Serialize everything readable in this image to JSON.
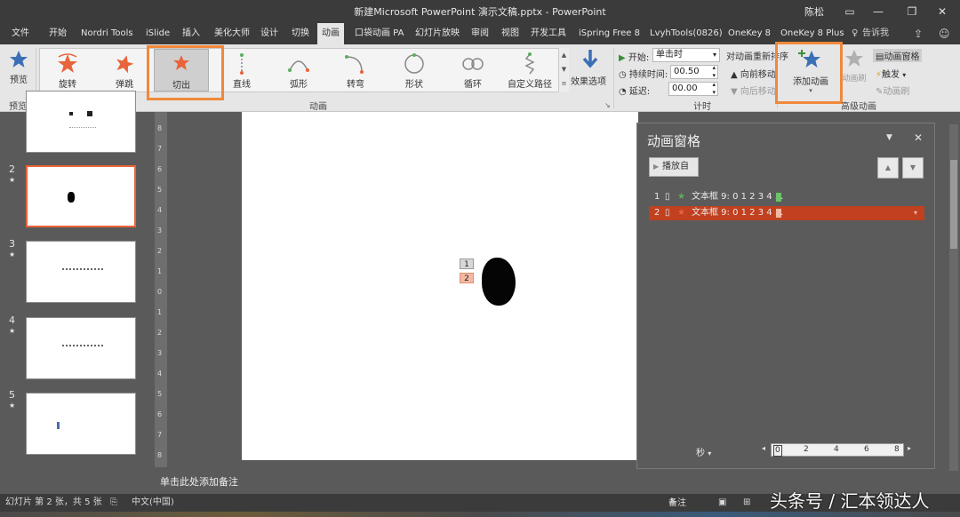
{
  "window": {
    "title": "新建Microsoft PowerPoint 演示文稿.pptx  -  PowerPoint",
    "user": "陈松"
  },
  "tabs": [
    "文件",
    "开始",
    "Nordri Tools",
    "iSlide",
    "插入",
    "美化大师",
    "设计",
    "切换",
    "动画",
    "口袋动画 PA",
    "幻灯片放映",
    "审阅",
    "视图",
    "开发工具",
    "iSpring Free 8",
    "LvyhTools(0826)",
    "OneKey 8",
    "OneKey 8 Plus"
  ],
  "tell_me": "告诉我",
  "ribbon": {
    "preview_label": "预览",
    "preview_group": "预览",
    "animations": [
      "旋转",
      "弹跳",
      "切出",
      "直线",
      "弧形",
      "转弯",
      "形状",
      "循环",
      "自定义路径"
    ],
    "effect_options": "效果选项",
    "animation_group": "动画",
    "timing": {
      "start_label": "开始:",
      "start_value": "单击时",
      "duration_label": "持续时间:",
      "duration_value": "00.50",
      "delay_label": "延迟:",
      "delay_value": "00.00",
      "reorder_title": "对动画重新排序",
      "move_earlier": "向前移动",
      "move_later": "向后移动",
      "group": "计时"
    },
    "advanced": {
      "add_animation": "添加动画",
      "animation_painter": "动画刷",
      "animation_pane": "动画窗格",
      "trigger": "触发",
      "animation_brush": "动画刷",
      "group": "高级动画"
    }
  },
  "slides": [
    {
      "num": "2",
      "star": "★"
    },
    {
      "num": "3",
      "star": "★"
    },
    {
      "num": "4",
      "star": "★"
    },
    {
      "num": "5",
      "star": "★"
    }
  ],
  "ruler": [
    "8",
    "7",
    "6",
    "5",
    "4",
    "3",
    "2",
    "1",
    "0",
    "1",
    "2",
    "3",
    "4",
    "5",
    "6",
    "7",
    "8"
  ],
  "canvas_tags": [
    "1",
    "2"
  ],
  "anim_pane": {
    "title": "动画窗格",
    "play_from": "播放自",
    "items": [
      {
        "order": "1",
        "text": "文本框 9: 0 1 2 3 4 ..."
      },
      {
        "order": "2",
        "text": "文本框 9: 0 1 2 3 4 ..."
      }
    ],
    "seconds": "秒",
    "timeline": [
      "0",
      "2",
      "4",
      "6",
      "8"
    ]
  },
  "notes_placeholder": "单击此处添加备注",
  "status": {
    "slide_info": "幻灯片 第 2 张，共 5 张",
    "language": "中文(中国)",
    "notes": "备注"
  },
  "watermark": "头条号 / 汇本领达人",
  "colors": {
    "accent_orange": "#f0883a",
    "selected_row": "#c0401f",
    "dark_chrome": "#3b3b3b"
  }
}
